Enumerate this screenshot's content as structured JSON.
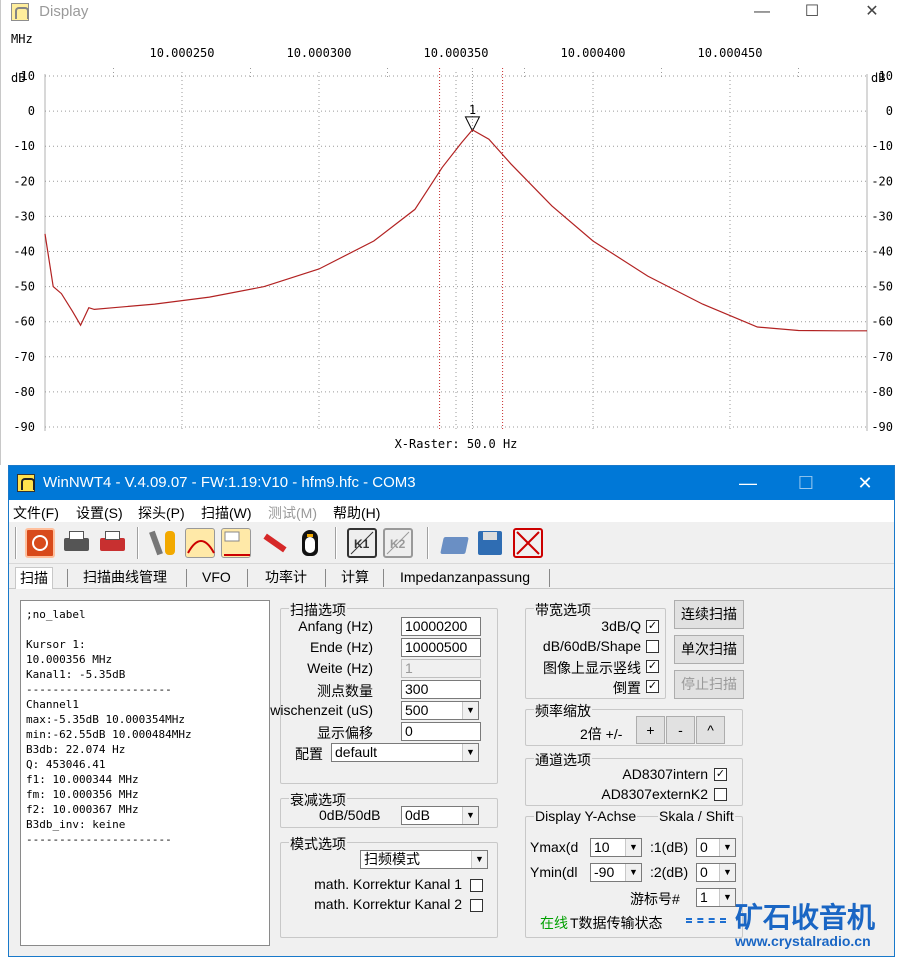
{
  "display_window": {
    "title": "Display",
    "controls": {
      "minimize": "—",
      "maximize": "☐",
      "close": "✕"
    },
    "unit_x": "MHz",
    "unit_y_left": "dB",
    "unit_y_right": "dB",
    "freq_ticks": [
      "10.000250",
      "10.000300",
      "10.000350",
      "10.000400",
      "10.000450"
    ],
    "db_ticks": [
      "10",
      "0",
      "-10",
      "-20",
      "-30",
      "-40",
      "-50",
      "-60",
      "-70",
      "-80",
      "-90"
    ],
    "x_raster": "X-Raster: 50.0 Hz",
    "marker_label": "1"
  },
  "chart_data": {
    "type": "line",
    "xlabel": "MHz",
    "ylabel": "dB",
    "xlim": [
      10.0002,
      10.0005
    ],
    "ylim": [
      -90,
      10
    ],
    "grid": true,
    "vertical_markers_mhz": [
      10.000344,
      10.000367
    ],
    "cursor": {
      "x": 10.000356,
      "y": -5.35,
      "label": "1"
    },
    "series": [
      {
        "color": "#b22222",
        "x": [
          10.0002,
          10.000203,
          10.000206,
          10.00021,
          10.000213,
          10.000216,
          10.000218,
          10.000225,
          10.00024,
          10.00026,
          10.00028,
          10.0003,
          10.00032,
          10.000335,
          10.000345,
          10.000352,
          10.000356,
          10.000362,
          10.00037,
          10.000385,
          10.0004,
          10.00042,
          10.00044,
          10.00046,
          10.000475,
          10.00049,
          10.0005
        ],
        "y": [
          -35,
          -50,
          -52,
          -57,
          -61,
          -56,
          -56.5,
          -56,
          -55,
          -53,
          -50,
          -45,
          -37,
          -28,
          -16,
          -9,
          -5.35,
          -8,
          -15,
          -27,
          -37,
          -47,
          -55,
          -61.5,
          -62.5,
          -62.6,
          -62.6
        ]
      }
    ]
  },
  "main_window": {
    "title": "WinNWT4 - V.4.09.07 - FW:1.19:V10 - hfm9.hfc - COM3",
    "controls": {
      "minimize": "—",
      "maximize": "☐",
      "close": "✕"
    },
    "menu": [
      "文件(F)",
      "设置(S)",
      "探头(P)",
      "扫描(W)",
      "测试(M)",
      "帮助(H)"
    ],
    "tabs": [
      "扫描",
      "扫描曲线管理",
      "VFO",
      "功率计",
      "计算",
      "Impedanzanpassung"
    ],
    "info_text": ";no_label\n\nKursor 1:\n10.000356 MHz\nKanal1: -5.35dB\n----------------------\nChannel1\nmax:-5.35dB 10.000354MHz\nmin:-62.55dB 10.000484MHz\nB3db: 22.074 Hz\nQ: 453046.41\nf1: 10.000344 MHz\nfm: 10.000356 MHz\nf2: 10.000367 MHz\nB3db_inv: keine\n----------------------",
    "scan_options": {
      "title": "扫描选项",
      "start_label": "Anfang (Hz)",
      "start_value": "10000200",
      "end_label": "Ende (Hz)",
      "end_value": "10000500",
      "width_label": "Weite (Hz)",
      "width_value": "1",
      "points_label": "测点数量",
      "points_value": "300",
      "delay_label": "wischenzeit (uS)",
      "delay_value": "500",
      "offset_label": "显示偏移",
      "offset_value": "0",
      "config_label": "配置",
      "config_value": "default"
    },
    "attenuation": {
      "title": "衰减选项",
      "label": "0dB/50dB",
      "value": "0dB"
    },
    "mode": {
      "title": "模式选项",
      "value": "扫频模式",
      "corr1": "math. Korrektur Kanal 1",
      "corr2": "math. Korrektur Kanal 2"
    },
    "bandwidth": {
      "title": "带宽选项",
      "q_label": "3dB/Q",
      "shape_label": "dB/60dB/Shape",
      "vline_label": "图像上显示竖线",
      "invert_label": "倒置"
    },
    "buttons": {
      "continuous": "连续扫描",
      "single": "单次扫描",
      "stop": "停止扫描"
    },
    "zoom": {
      "title": "频率缩放",
      "label": "2倍 +/-",
      "plus": "+",
      "minus": "-",
      "caret": "^"
    },
    "channel": {
      "title": "通道选项",
      "intern": "AD8307intern",
      "extern": "AD8307externK2"
    },
    "display_y": {
      "title": "Display Y-Achse",
      "title2": "Skala / Shift",
      "ymax_label": "Ymax(d",
      "ymax_value": "10",
      "ymin_label": "Ymin(dl",
      "ymin_value": "-90",
      "k1_label": ":1(dB)",
      "k1_value": "0",
      "k2_label": ":2(dB)",
      "k2_value": "0",
      "cursor_label": "游标号#",
      "cursor_value": "1",
      "status_online": "在线",
      "status_text": "T数据传输状态"
    },
    "watermark": {
      "cn": "矿石收音机",
      "url": "www.crystalradio.cn"
    }
  }
}
